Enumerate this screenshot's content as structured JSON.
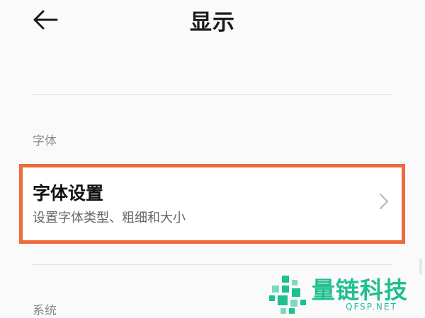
{
  "header": {
    "title": "显示",
    "back_icon": "arrow-left-icon"
  },
  "sections": [
    {
      "header": "字体",
      "items": [
        {
          "title": "字体设置",
          "subtitle": "设置字体类型、粗细和大小",
          "icon": "chevron-right-icon",
          "highlighted": true,
          "highlight_color": "#ee6a3c"
        }
      ]
    },
    {
      "header": "系统"
    }
  ],
  "watermark": {
    "name": "量链科技",
    "url": "QFSP.NET",
    "color": "#1fbf8f"
  }
}
